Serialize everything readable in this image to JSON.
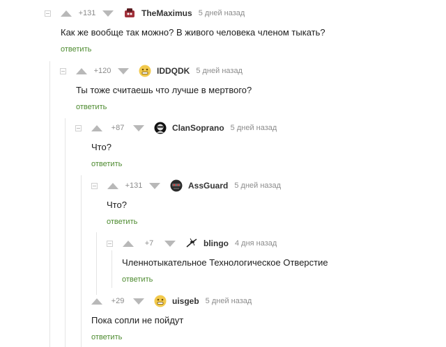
{
  "comments": [
    {
      "rating": "+131",
      "author": "TheMaximus",
      "date": "5 дней назад",
      "text": "Как же вообще так можно? В живого человека членом тыкать?",
      "reply_label": "ответить",
      "avatar_color": "#a0303a"
    },
    {
      "rating": "+120",
      "author": "IDDQDK",
      "date": "5 дней назад",
      "text": "Ты тоже считаешь что лучше в мертвого?",
      "reply_label": "ответить",
      "avatar_color": "#f2c94c"
    },
    {
      "rating": "+87",
      "author": "ClanSoprano",
      "date": "5 дней назад",
      "text": "Что?",
      "reply_label": "ответить",
      "avatar_color": "#111111"
    },
    {
      "rating": "+131",
      "author": "AssGuard",
      "date": "5 дней назад",
      "text": "Что?",
      "reply_label": "ответить",
      "avatar_color": "#2a2a2a"
    },
    {
      "rating": "+7",
      "author": "blingo",
      "date": "4 дня назад",
      "text": "Членнотыкательное Технологическое Отверстие",
      "reply_label": "ответить",
      "avatar_color": "#222222"
    },
    {
      "rating": "+29",
      "author": "uisgeb",
      "date": "5 дней назад",
      "text": "Пока сопли не пойдут",
      "reply_label": "ответить",
      "avatar_color": "#f2c94c"
    }
  ]
}
